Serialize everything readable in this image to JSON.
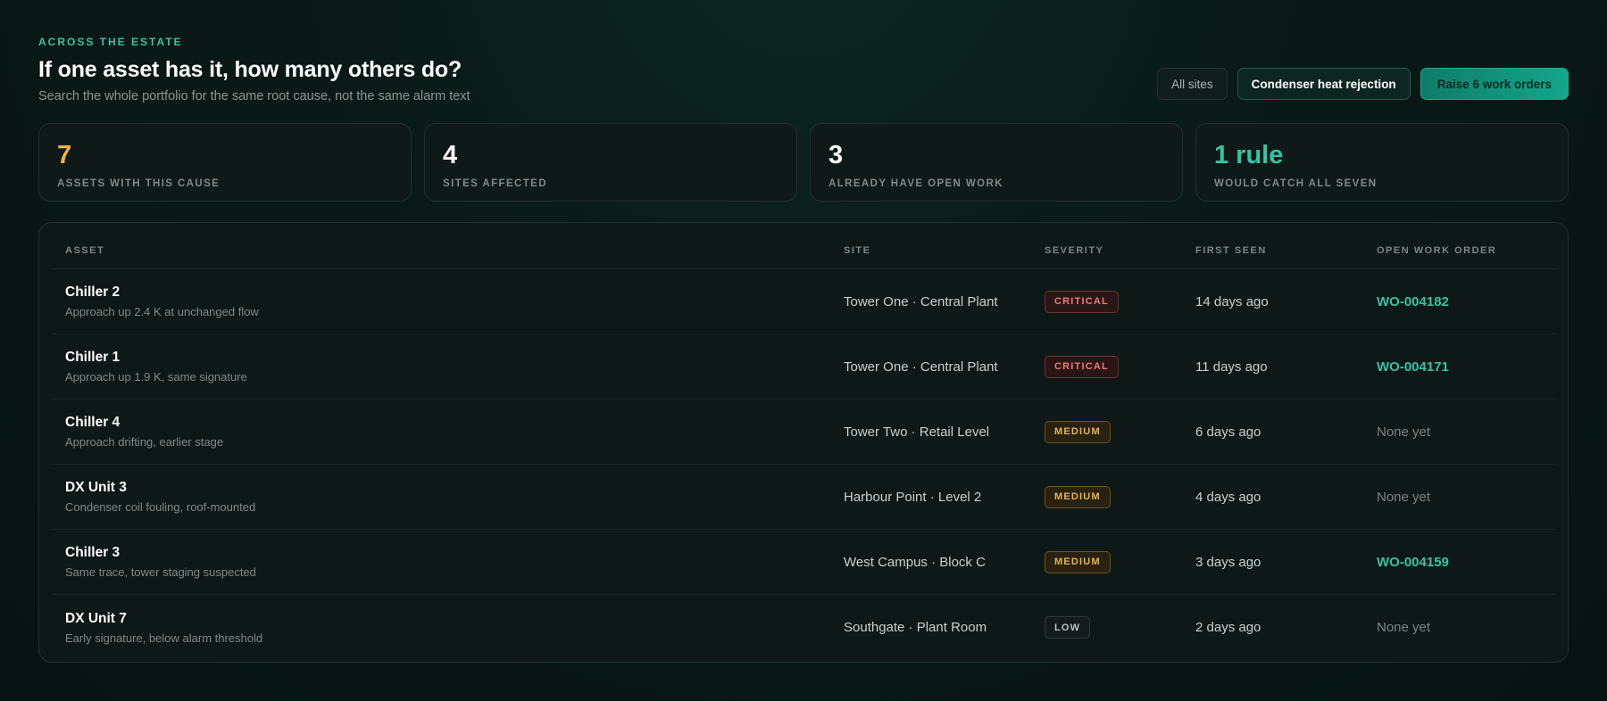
{
  "header": {
    "eyebrow": "ACROSS THE ESTATE",
    "title": "If one asset has it, how many others do?",
    "subtitle": "Search the whole portfolio for the same root cause, not the same alarm text"
  },
  "actions": {
    "scope_label": "All sites",
    "filter_label": "Condenser heat rejection",
    "primary_label": "Raise 6 work orders"
  },
  "stats": [
    {
      "value": "7",
      "label": "ASSETS WITH THIS CAUSE",
      "color": "#f4b04a"
    },
    {
      "value": "4",
      "label": "SITES AFFECTED",
      "color": "#ffffff"
    },
    {
      "value": "3",
      "label": "ALREADY HAVE OPEN WORK",
      "color": "#ffffff"
    },
    {
      "value": "1 rule",
      "label": "WOULD CATCH ALL SEVEN",
      "color": "#34c4a6"
    }
  ],
  "table": {
    "columns": {
      "asset": "ASSET",
      "site": "SITE",
      "severity": "SEVERITY",
      "first_seen": "FIRST SEEN",
      "work_order": "OPEN WORK ORDER"
    },
    "rows": [
      {
        "asset": "Chiller 2",
        "note": "Approach up 2.4 K at unchanged flow",
        "site": "Tower One · Central Plant",
        "severity": "CRITICAL",
        "first_seen": "14 days ago",
        "work_order": "WO-004182"
      },
      {
        "asset": "Chiller 1",
        "note": "Approach up 1.9 K, same signature",
        "site": "Tower One · Central Plant",
        "severity": "CRITICAL",
        "first_seen": "11 days ago",
        "work_order": "WO-004171"
      },
      {
        "asset": "Chiller 4",
        "note": "Approach drifting, earlier stage",
        "site": "Tower Two · Retail Level",
        "severity": "MEDIUM",
        "first_seen": "6 days ago",
        "work_order": "None yet"
      },
      {
        "asset": "DX Unit 3",
        "note": "Condenser coil fouling, roof-mounted",
        "site": "Harbour Point · Level 2",
        "severity": "MEDIUM",
        "first_seen": "4 days ago",
        "work_order": "None yet"
      },
      {
        "asset": "Chiller 3",
        "note": "Same trace, tower staging suspected",
        "site": "West Campus · Block C",
        "severity": "MEDIUM",
        "first_seen": "3 days ago",
        "work_order": "WO-004159"
      },
      {
        "asset": "DX Unit 7",
        "note": "Early signature, below alarm threshold",
        "site": "Southgate · Plant Room",
        "severity": "LOW",
        "first_seen": "2 days ago",
        "work_order": "None yet"
      }
    ]
  }
}
